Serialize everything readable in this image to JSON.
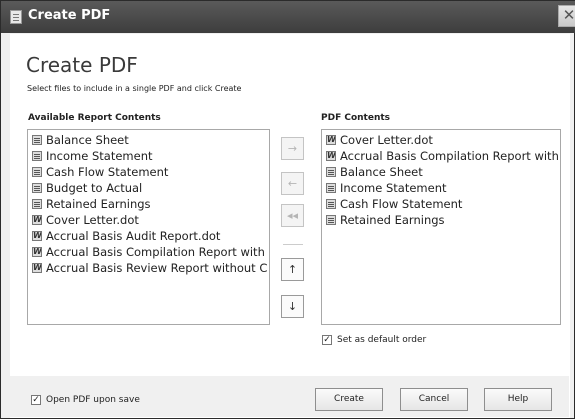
{
  "window": {
    "title": "Create PDF",
    "close_glyph": "✕"
  },
  "header": {
    "title": "Create PDF",
    "subtitle": "Select files to include in a single PDF and click Create"
  },
  "available": {
    "label": "Available Report Contents",
    "items": [
      {
        "label": "Balance Sheet",
        "icon": "report-icon"
      },
      {
        "label": "Income Statement",
        "icon": "report-icon"
      },
      {
        "label": "Cash Flow Statement",
        "icon": "report-icon"
      },
      {
        "label": "Budget to Actual",
        "icon": "report-icon"
      },
      {
        "label": "Retained Earnings",
        "icon": "report-icon"
      },
      {
        "label": "Cover Letter.dot",
        "icon": "word-icon"
      },
      {
        "label": "Accrual Basis Audit Report.dot",
        "icon": "word-icon"
      },
      {
        "label": "Accrual Basis Compilation Report with",
        "icon": "word-icon"
      },
      {
        "label": "Accrual Basis Review Report without C",
        "icon": "word-icon"
      }
    ]
  },
  "pdf_contents": {
    "label": "PDF Contents",
    "items": [
      {
        "label": "Cover Letter.dot",
        "icon": "word-icon"
      },
      {
        "label": "Accrual Basis Compilation Report with",
        "icon": "word-icon"
      },
      {
        "label": "Balance Sheet",
        "icon": "report-icon"
      },
      {
        "label": "Income Statement",
        "icon": "report-icon"
      },
      {
        "label": "Cash Flow Statement",
        "icon": "report-icon"
      },
      {
        "label": "Retained Earnings",
        "icon": "report-icon"
      }
    ]
  },
  "move_buttons": {
    "add": "→",
    "remove": "←",
    "remove_all": "◂◂",
    "up": "↑",
    "down": "↓"
  },
  "options": {
    "default_order_label": "Set as default order",
    "default_order_checked": true,
    "open_pdf_label": "Open PDF upon save",
    "open_pdf_checked": true
  },
  "buttons": {
    "create": "Create",
    "cancel": "Cancel",
    "help": "Help"
  }
}
